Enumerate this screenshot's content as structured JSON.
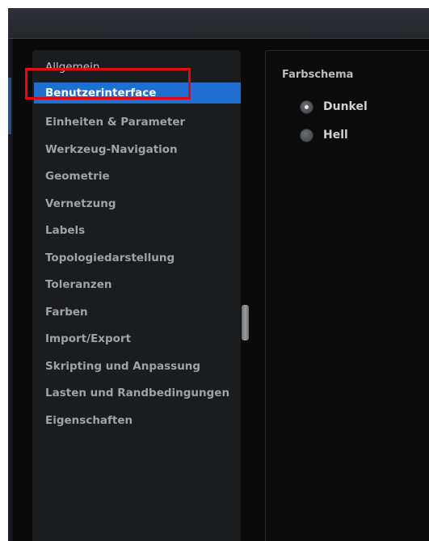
{
  "window": {
    "title": ""
  },
  "sidebar": {
    "items": [
      {
        "label": "Allgemein"
      },
      {
        "label": "Benutzerinterface"
      },
      {
        "label": "Einheiten & Parameter"
      },
      {
        "label": "Werkzeug-Navigation"
      },
      {
        "label": "Geometrie"
      },
      {
        "label": "Vernetzung"
      },
      {
        "label": "Labels"
      },
      {
        "label": "Topologiedarstellung"
      },
      {
        "label": "Toleranzen"
      },
      {
        "label": "Farben"
      },
      {
        "label": "Import/Export"
      },
      {
        "label": "Skripting und Anpassung"
      },
      {
        "label": "Lasten und Randbedingungen"
      },
      {
        "label": "Eigenschaften"
      }
    ],
    "selected": "Benutzerinterface"
  },
  "content": {
    "section_title": "Farbschema",
    "options": [
      {
        "label": "Dunkel",
        "checked": true
      },
      {
        "label": "Hell",
        "checked": false
      }
    ]
  },
  "colors": {
    "selection": "#1e6fd0",
    "highlight_frame": "#e30613",
    "panel_background": "#1b1c1e",
    "window_background": "#0a0a0a"
  }
}
